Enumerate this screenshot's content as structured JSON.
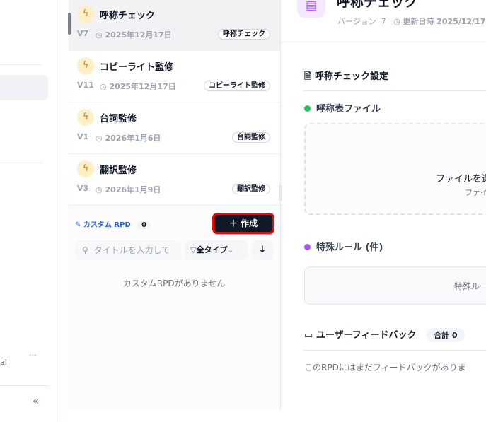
{
  "sidebar": {
    "partial_text": "al",
    "more_label": "···",
    "collapse_label": "«"
  },
  "rpd_list": [
    {
      "title": "呼称チェック",
      "version": "V7",
      "date": "2025年12月17日",
      "tag": "呼称チェック",
      "selected": true
    },
    {
      "title": "コピーライト監修",
      "version": "V11",
      "date": "2025年12月17日",
      "tag": "コピーライト監修",
      "selected": false
    },
    {
      "title": "台詞監修",
      "version": "V1",
      "date": "2026年1月6日",
      "tag": "台詞監修",
      "selected": false
    },
    {
      "title": "翻訳監修",
      "version": "V3",
      "date": "2026年1月9日",
      "tag": "翻訳監修",
      "selected": false
    }
  ],
  "custom": {
    "label": "カスタム RPD",
    "count": "0",
    "create_label": "作成",
    "search_placeholder": "タイトルを入力して",
    "type_filter": "全タイプ",
    "empty": "カスタムRPDがありません"
  },
  "main": {
    "title": "呼称チェック",
    "version_label": "バージョン",
    "version": "7",
    "updated": "更新日時 2025/12/17",
    "settings_heading": "呼称チェック設定",
    "file_heading": "呼称表ファイル",
    "drop_text": "ファイルを選",
    "drop_sub": "ファイ",
    "rules_heading": "特殊ルール (件)",
    "rules_empty": "特殊ルー",
    "feedback_heading": "ユーザーフィードバック",
    "feedback_total": "合計 0",
    "feedback_empty": "このRPDにはまだフィードバックがありま"
  },
  "colors": {
    "accent": "#2563eb",
    "create_bg": "#111827",
    "highlight": "#ff0000",
    "green": "#22c55e",
    "purple": "#a855f7"
  }
}
